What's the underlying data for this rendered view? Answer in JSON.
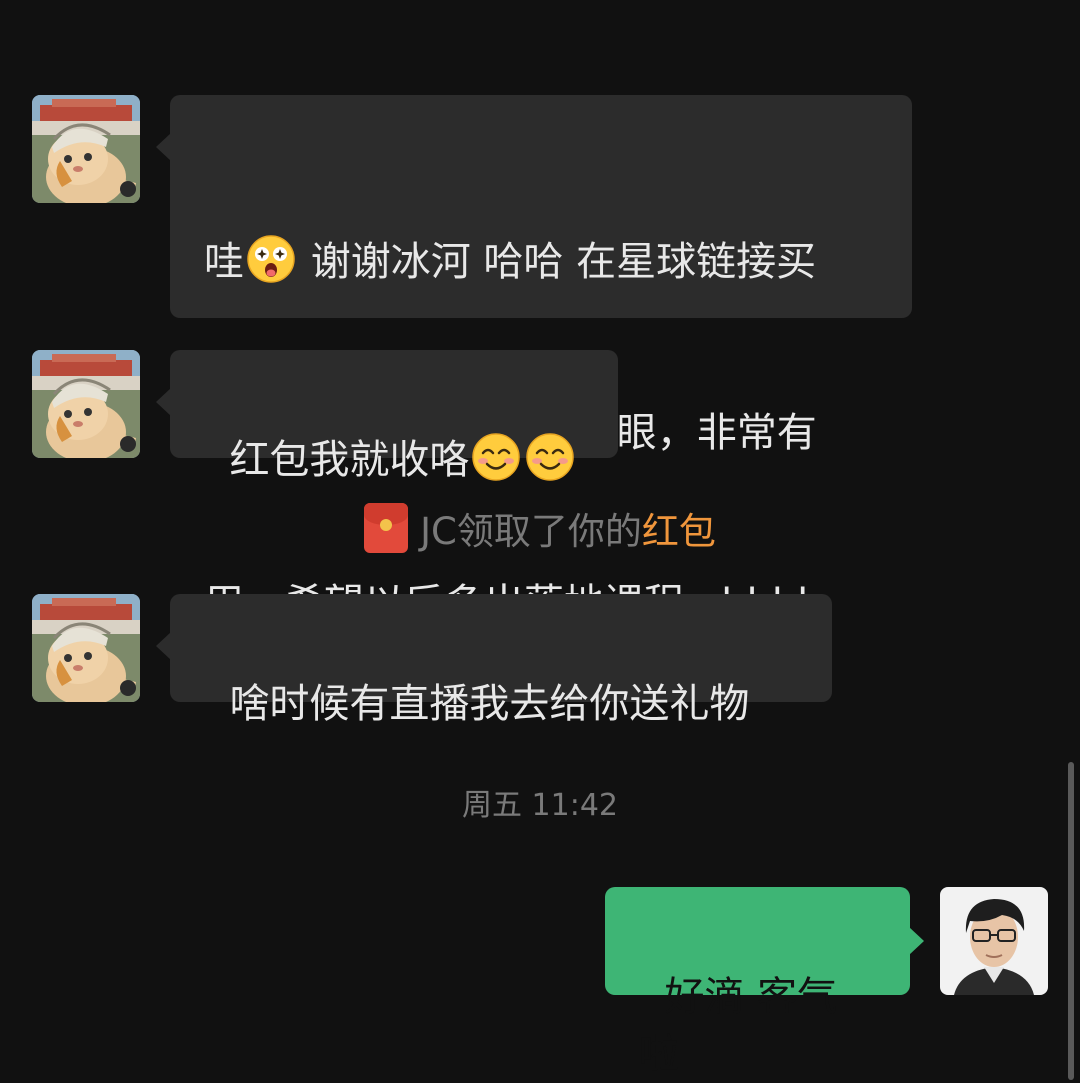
{
  "messages": {
    "m1": {
      "line1_a": "哇",
      "line1_b": " 谢谢冰河 哈哈 在星球链接买",
      "line2": "的 视频看了几遍，开了眼，非常有",
      "line3": "用，希望以后多出落地课程 ahhhh",
      "emoji": "star-struck-face"
    },
    "m2": {
      "text": "红包我就收咯",
      "emoji": "smiling-face-with-smiling-eyes"
    },
    "m3": {
      "text": "啥时候有直播我去给你送礼物"
    },
    "m4": {
      "text": "好滴 客气啦"
    }
  },
  "system_notice": {
    "prefix": "JC领取了你的",
    "link": "红包",
    "icon": "red-packet-icon"
  },
  "timestamp": "周五 11:42",
  "colors": {
    "background": "#111111",
    "incoming_bubble": "#2c2c2c",
    "outgoing_bubble": "#3eb575",
    "link": "#f0963c",
    "system_text": "#7a7a7a"
  }
}
